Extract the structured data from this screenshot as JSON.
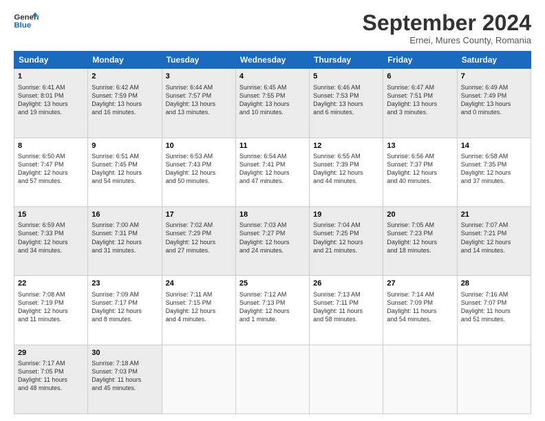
{
  "header": {
    "logo_line1": "General",
    "logo_line2": "Blue",
    "month_title": "September 2024",
    "subtitle": "Ernei, Mures County, Romania"
  },
  "days_of_week": [
    "Sunday",
    "Monday",
    "Tuesday",
    "Wednesday",
    "Thursday",
    "Friday",
    "Saturday"
  ],
  "weeks": [
    [
      {
        "day": "1",
        "info": "Sunrise: 6:41 AM\nSunset: 8:01 PM\nDaylight: 13 hours\nand 19 minutes."
      },
      {
        "day": "2",
        "info": "Sunrise: 6:42 AM\nSunset: 7:59 PM\nDaylight: 13 hours\nand 16 minutes."
      },
      {
        "day": "3",
        "info": "Sunrise: 6:44 AM\nSunset: 7:57 PM\nDaylight: 13 hours\nand 13 minutes."
      },
      {
        "day": "4",
        "info": "Sunrise: 6:45 AM\nSunset: 7:55 PM\nDaylight: 13 hours\nand 10 minutes."
      },
      {
        "day": "5",
        "info": "Sunrise: 6:46 AM\nSunset: 7:53 PM\nDaylight: 13 hours\nand 6 minutes."
      },
      {
        "day": "6",
        "info": "Sunrise: 6:47 AM\nSunset: 7:51 PM\nDaylight: 13 hours\nand 3 minutes."
      },
      {
        "day": "7",
        "info": "Sunrise: 6:49 AM\nSunset: 7:49 PM\nDaylight: 13 hours\nand 0 minutes."
      }
    ],
    [
      {
        "day": "8",
        "info": "Sunrise: 6:50 AM\nSunset: 7:47 PM\nDaylight: 12 hours\nand 57 minutes."
      },
      {
        "day": "9",
        "info": "Sunrise: 6:51 AM\nSunset: 7:45 PM\nDaylight: 12 hours\nand 54 minutes."
      },
      {
        "day": "10",
        "info": "Sunrise: 6:53 AM\nSunset: 7:43 PM\nDaylight: 12 hours\nand 50 minutes."
      },
      {
        "day": "11",
        "info": "Sunrise: 6:54 AM\nSunset: 7:41 PM\nDaylight: 12 hours\nand 47 minutes."
      },
      {
        "day": "12",
        "info": "Sunrise: 6:55 AM\nSunset: 7:39 PM\nDaylight: 12 hours\nand 44 minutes."
      },
      {
        "day": "13",
        "info": "Sunrise: 6:56 AM\nSunset: 7:37 PM\nDaylight: 12 hours\nand 40 minutes."
      },
      {
        "day": "14",
        "info": "Sunrise: 6:58 AM\nSunset: 7:35 PM\nDaylight: 12 hours\nand 37 minutes."
      }
    ],
    [
      {
        "day": "15",
        "info": "Sunrise: 6:59 AM\nSunset: 7:33 PM\nDaylight: 12 hours\nand 34 minutes."
      },
      {
        "day": "16",
        "info": "Sunrise: 7:00 AM\nSunset: 7:31 PM\nDaylight: 12 hours\nand 31 minutes."
      },
      {
        "day": "17",
        "info": "Sunrise: 7:02 AM\nSunset: 7:29 PM\nDaylight: 12 hours\nand 27 minutes."
      },
      {
        "day": "18",
        "info": "Sunrise: 7:03 AM\nSunset: 7:27 PM\nDaylight: 12 hours\nand 24 minutes."
      },
      {
        "day": "19",
        "info": "Sunrise: 7:04 AM\nSunset: 7:25 PM\nDaylight: 12 hours\nand 21 minutes."
      },
      {
        "day": "20",
        "info": "Sunrise: 7:05 AM\nSunset: 7:23 PM\nDaylight: 12 hours\nand 18 minutes."
      },
      {
        "day": "21",
        "info": "Sunrise: 7:07 AM\nSunset: 7:21 PM\nDaylight: 12 hours\nand 14 minutes."
      }
    ],
    [
      {
        "day": "22",
        "info": "Sunrise: 7:08 AM\nSunset: 7:19 PM\nDaylight: 12 hours\nand 11 minutes."
      },
      {
        "day": "23",
        "info": "Sunrise: 7:09 AM\nSunset: 7:17 PM\nDaylight: 12 hours\nand 8 minutes."
      },
      {
        "day": "24",
        "info": "Sunrise: 7:11 AM\nSunset: 7:15 PM\nDaylight: 12 hours\nand 4 minutes."
      },
      {
        "day": "25",
        "info": "Sunrise: 7:12 AM\nSunset: 7:13 PM\nDaylight: 12 hours\nand 1 minute."
      },
      {
        "day": "26",
        "info": "Sunrise: 7:13 AM\nSunset: 7:11 PM\nDaylight: 11 hours\nand 58 minutes."
      },
      {
        "day": "27",
        "info": "Sunrise: 7:14 AM\nSunset: 7:09 PM\nDaylight: 11 hours\nand 54 minutes."
      },
      {
        "day": "28",
        "info": "Sunrise: 7:16 AM\nSunset: 7:07 PM\nDaylight: 11 hours\nand 51 minutes."
      }
    ],
    [
      {
        "day": "29",
        "info": "Sunrise: 7:17 AM\nSunset: 7:05 PM\nDaylight: 11 hours\nand 48 minutes."
      },
      {
        "day": "30",
        "info": "Sunrise: 7:18 AM\nSunset: 7:03 PM\nDaylight: 11 hours\nand 45 minutes."
      },
      {
        "day": "",
        "info": ""
      },
      {
        "day": "",
        "info": ""
      },
      {
        "day": "",
        "info": ""
      },
      {
        "day": "",
        "info": ""
      },
      {
        "day": "",
        "info": ""
      }
    ]
  ]
}
